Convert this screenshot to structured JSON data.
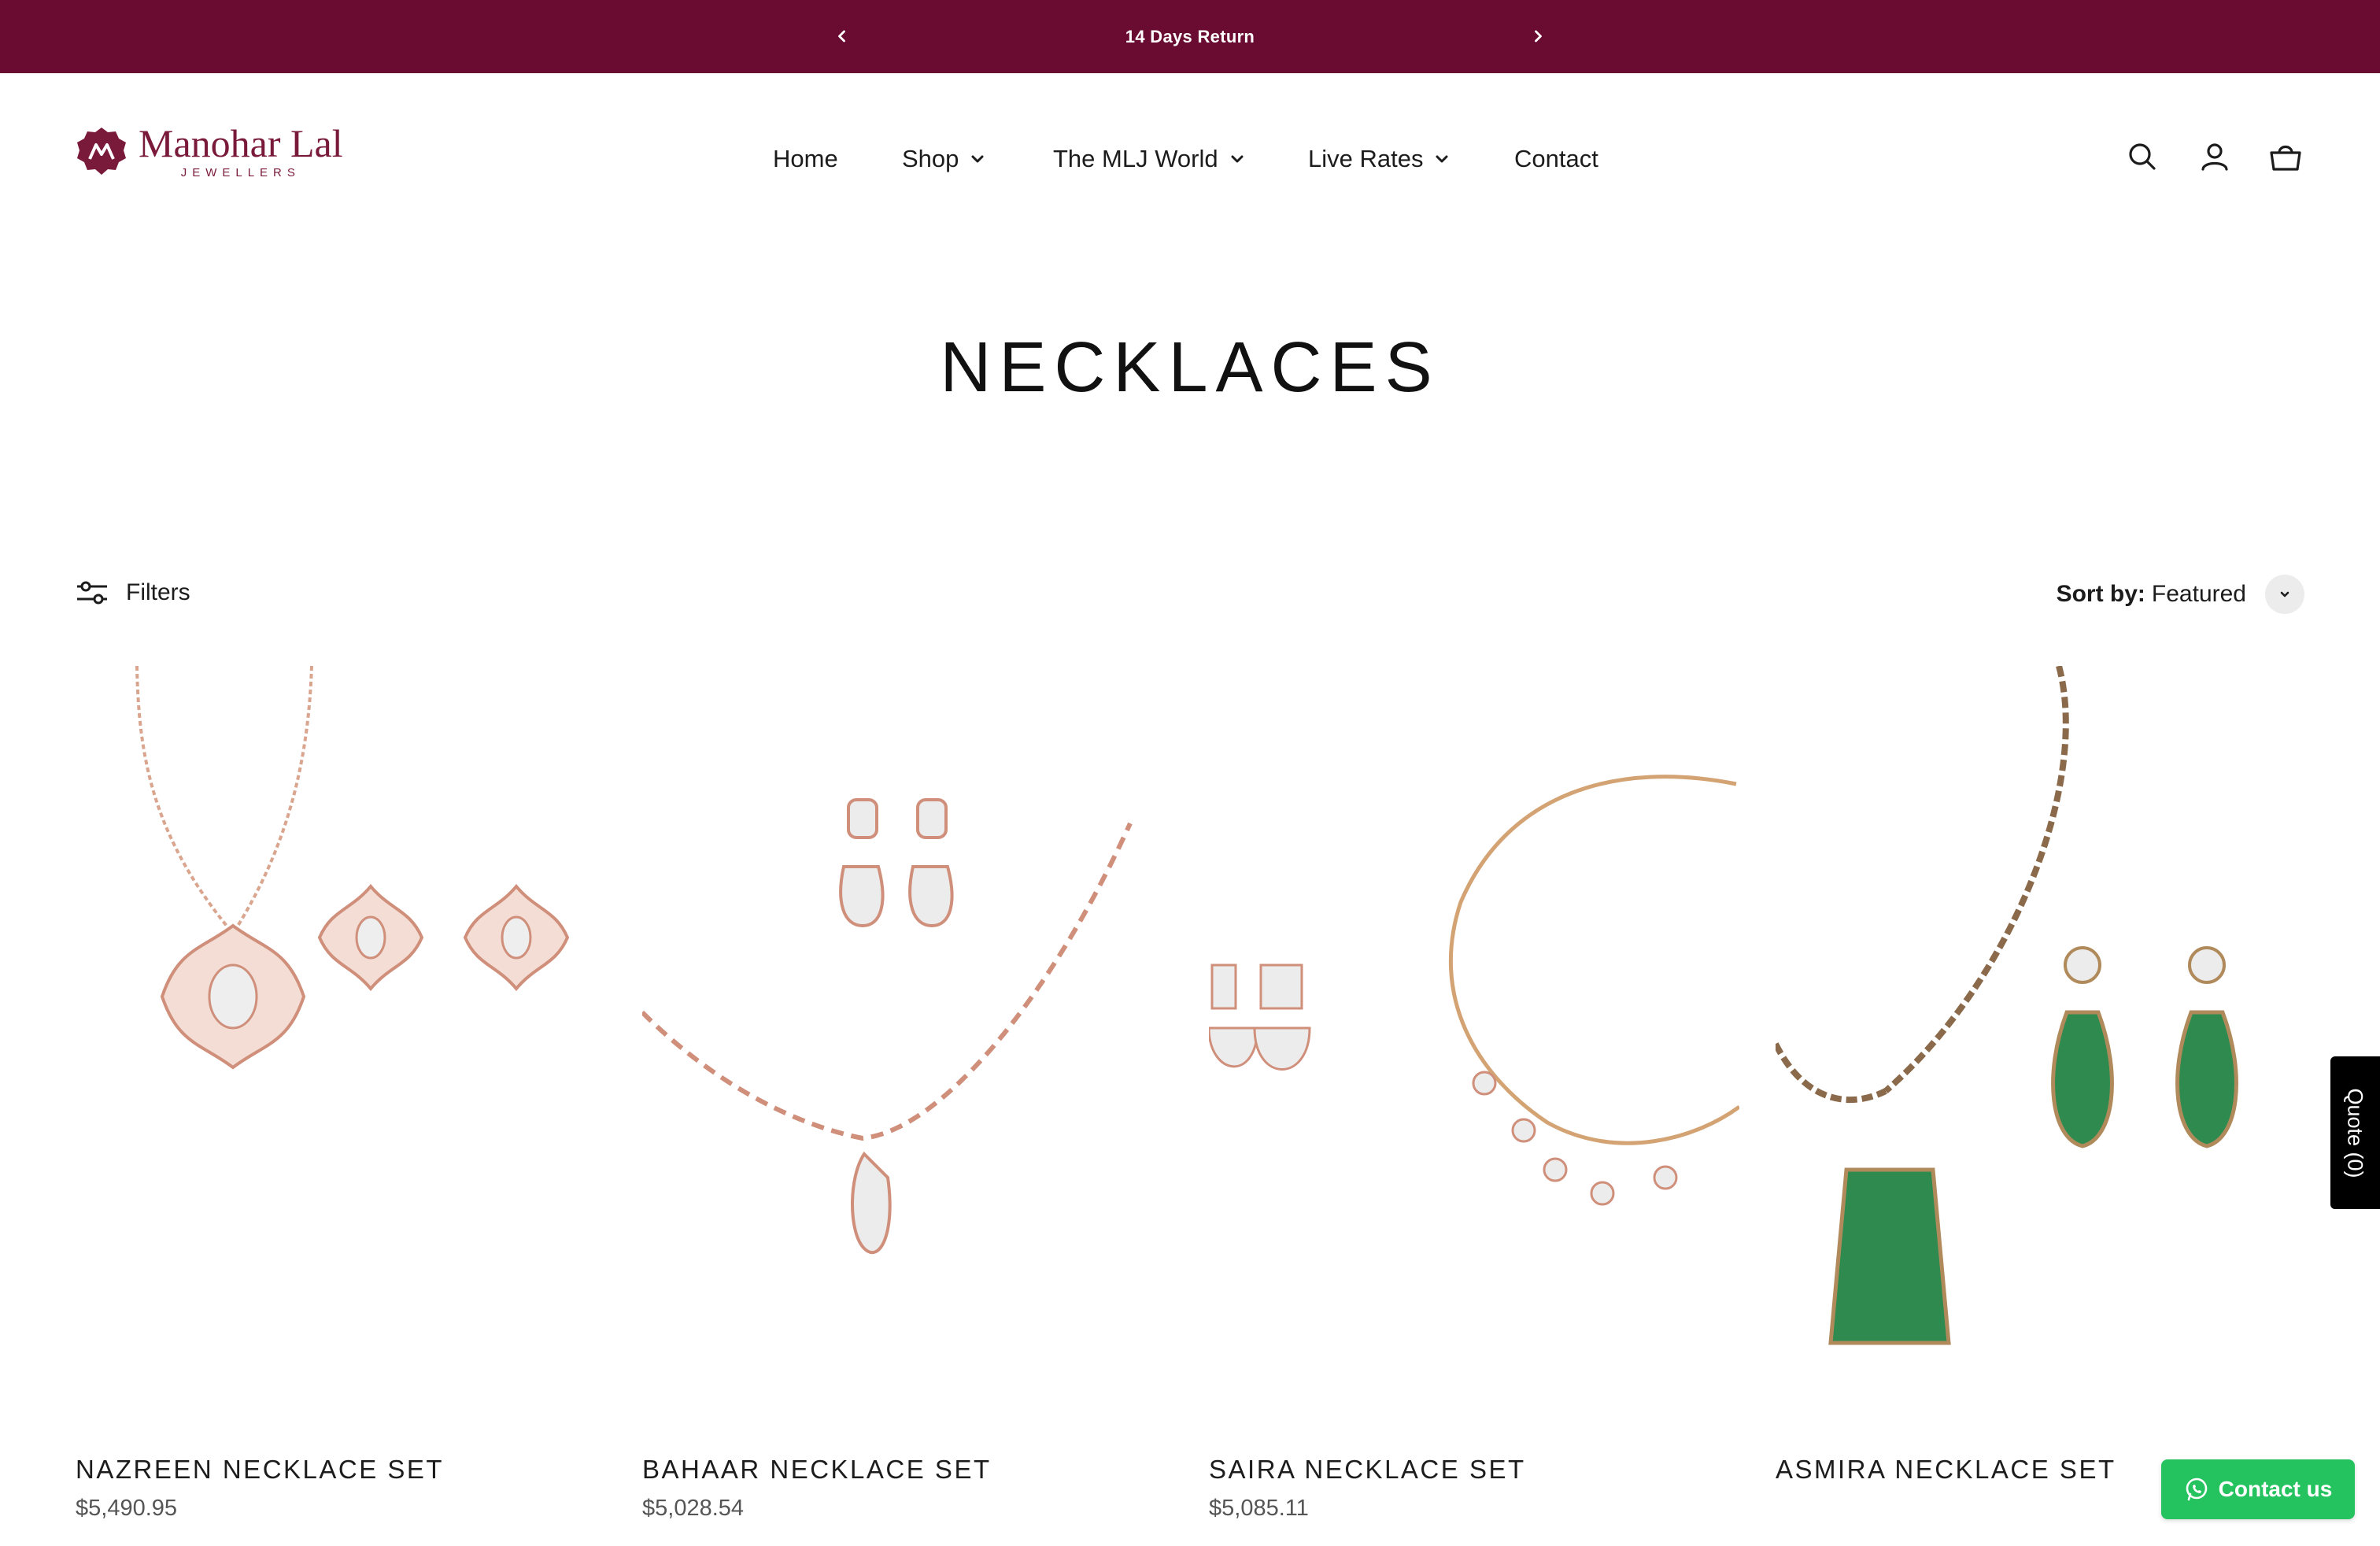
{
  "announcement": {
    "message": "14 Days Return",
    "background": "#6a0c31"
  },
  "logo": {
    "brand": "Manohar Lal",
    "subtitle": "JEWELLERS",
    "color": "#7a1a3a"
  },
  "nav": {
    "items": [
      {
        "label": "Home",
        "has_dropdown": false
      },
      {
        "label": "Shop",
        "has_dropdown": true
      },
      {
        "label": "The MLJ World",
        "has_dropdown": true
      },
      {
        "label": "Live Rates",
        "has_dropdown": true
      },
      {
        "label": "Contact",
        "has_dropdown": false
      }
    ]
  },
  "header_icons": [
    "search-icon",
    "account-icon",
    "cart-icon"
  ],
  "page": {
    "title": "NECKLACES"
  },
  "toolbar": {
    "filters_label": "Filters",
    "sort_label": "Sort by:",
    "sort_value": "Featured"
  },
  "products": [
    {
      "name": "NAZREEN NECKLACE SET",
      "price": "$5,490.95"
    },
    {
      "name": "BAHAAR NECKLACE SET",
      "price": "$5,028.54"
    },
    {
      "name": "SAIRA NECKLACE SET",
      "price": "$5,085.11"
    },
    {
      "name": "ASMIRA NECKLACE SET",
      "price": ""
    }
  ],
  "quote_tab": {
    "label": "Quote (0)"
  },
  "contact_button": {
    "label": "Contact us",
    "color": "#25c35f"
  }
}
